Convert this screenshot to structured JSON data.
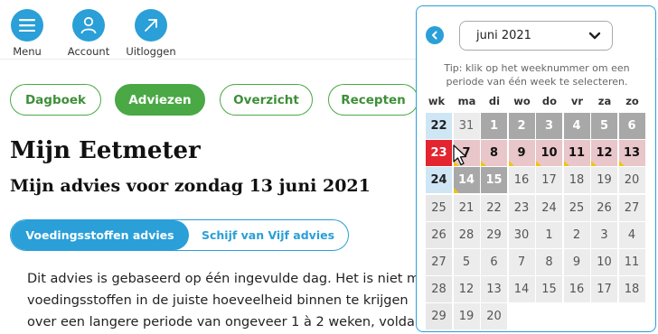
{
  "nav": {
    "menu_label": "Menu",
    "account_label": "Account",
    "logout_label": "Uitloggen"
  },
  "tabs": [
    "Dagboek",
    "Adviezen",
    "Overzicht",
    "Recepten"
  ],
  "active_tab": "Adviezen",
  "page": {
    "title": "Mijn Eetmeter",
    "subtitle": "Mijn advies voor zondag 13 juni 2021"
  },
  "subtabs": [
    "Voedingsstoffen advies",
    "Schijf van Vijf advies"
  ],
  "active_subtab": "Voedingsstoffen advies",
  "advice_lines": [
    "Dit advies is gebaseerd op één ingevulde dag. Het is niet m",
    "voedingsstoffen in de juiste hoeveelheid binnen te krijgen",
    "over een langere periode van ongeveer 1 à 2 weken, volda"
  ],
  "datepicker": {
    "month_label": "juni 2021",
    "tip": "Tip: klik op het weeknummer om een periode van één week te selecteren.",
    "week_header": "wk",
    "day_headers": [
      "ma",
      "di",
      "wo",
      "do",
      "vr",
      "za",
      "zo"
    ],
    "weeks": [
      {
        "wk": "22",
        "wk_state": "highlight",
        "days": [
          {
            "n": "31",
            "state": "outside",
            "mark": false
          },
          {
            "n": "1",
            "state": "gray",
            "mark": false
          },
          {
            "n": "2",
            "state": "gray",
            "mark": false
          },
          {
            "n": "3",
            "state": "gray",
            "mark": false
          },
          {
            "n": "4",
            "state": "gray",
            "mark": false
          },
          {
            "n": "5",
            "state": "gray",
            "mark": false
          },
          {
            "n": "6",
            "state": "gray",
            "mark": false
          }
        ]
      },
      {
        "wk": "23",
        "wk_state": "selected",
        "days": [
          {
            "n": "7",
            "state": "pink",
            "mark": true
          },
          {
            "n": "8",
            "state": "pink",
            "mark": true
          },
          {
            "n": "9",
            "state": "pink",
            "mark": true
          },
          {
            "n": "10",
            "state": "pink",
            "mark": true
          },
          {
            "n": "11",
            "state": "pink",
            "mark": true
          },
          {
            "n": "12",
            "state": "pink",
            "mark": true
          },
          {
            "n": "13",
            "state": "pink",
            "mark": true
          }
        ]
      },
      {
        "wk": "24",
        "wk_state": "highlight",
        "days": [
          {
            "n": "14",
            "state": "gray",
            "mark": true
          },
          {
            "n": "15",
            "state": "gray",
            "mark": false
          },
          {
            "n": "16",
            "state": "normal",
            "mark": false
          },
          {
            "n": "17",
            "state": "normal",
            "mark": false
          },
          {
            "n": "18",
            "state": "normal",
            "mark": false
          },
          {
            "n": "19",
            "state": "normal",
            "mark": false
          },
          {
            "n": "20",
            "state": "normal",
            "mark": false
          }
        ]
      },
      {
        "wk": "25",
        "wk_state": "normal",
        "days": [
          {
            "n": "21",
            "state": "normal",
            "mark": false
          },
          {
            "n": "22",
            "state": "normal",
            "mark": false
          },
          {
            "n": "23",
            "state": "normal",
            "mark": false
          },
          {
            "n": "24",
            "state": "normal",
            "mark": false
          },
          {
            "n": "25",
            "state": "normal",
            "mark": false
          },
          {
            "n": "26",
            "state": "normal",
            "mark": false
          },
          {
            "n": "27",
            "state": "normal",
            "mark": false
          }
        ]
      },
      {
        "wk": "26",
        "wk_state": "normal",
        "days": [
          {
            "n": "28",
            "state": "normal",
            "mark": false
          },
          {
            "n": "29",
            "state": "normal",
            "mark": false
          },
          {
            "n": "30",
            "state": "normal",
            "mark": false
          },
          {
            "n": "1",
            "state": "normal",
            "mark": false
          },
          {
            "n": "2",
            "state": "normal",
            "mark": false
          },
          {
            "n": "3",
            "state": "normal",
            "mark": false
          },
          {
            "n": "4",
            "state": "normal",
            "mark": false
          }
        ]
      },
      {
        "wk": "27",
        "wk_state": "normal",
        "days": [
          {
            "n": "5",
            "state": "normal",
            "mark": false
          },
          {
            "n": "6",
            "state": "normal",
            "mark": false
          },
          {
            "n": "7",
            "state": "normal",
            "mark": false
          },
          {
            "n": "8",
            "state": "normal",
            "mark": false
          },
          {
            "n": "9",
            "state": "normal",
            "mark": false
          },
          {
            "n": "10",
            "state": "normal",
            "mark": false
          },
          {
            "n": "11",
            "state": "normal",
            "mark": false
          }
        ]
      },
      {
        "wk": "28",
        "wk_state": "normal",
        "days": [
          {
            "n": "12",
            "state": "normal",
            "mark": false
          },
          {
            "n": "13",
            "state": "normal",
            "mark": false
          },
          {
            "n": "14",
            "state": "normal",
            "mark": false
          },
          {
            "n": "15",
            "state": "normal",
            "mark": false
          },
          {
            "n": "16",
            "state": "normal",
            "mark": false
          },
          {
            "n": "17",
            "state": "normal",
            "mark": false
          },
          {
            "n": "18",
            "state": "normal",
            "mark": false
          }
        ]
      },
      {
        "wk": "29",
        "wk_state": "normal",
        "days": [
          {
            "n": "19",
            "state": "normal",
            "mark": false
          },
          {
            "n": "20",
            "state": "normal",
            "mark": false
          }
        ]
      }
    ]
  },
  "colors": {
    "blue": "#2a9fd8",
    "green": "#4aa845",
    "red": "#e2252f",
    "pink": "#e8c6c9",
    "gray": "#a8a8a8",
    "advice_bg": "#f6f2dc",
    "marker": "#f1c40f"
  },
  "icons": {
    "menu": "hamburger-icon",
    "account": "user-icon",
    "logout": "arrow-up-right-icon",
    "prev": "chevron-left-icon",
    "dropdown": "chevron-down-icon",
    "cursor": "mouse-pointer-icon"
  }
}
